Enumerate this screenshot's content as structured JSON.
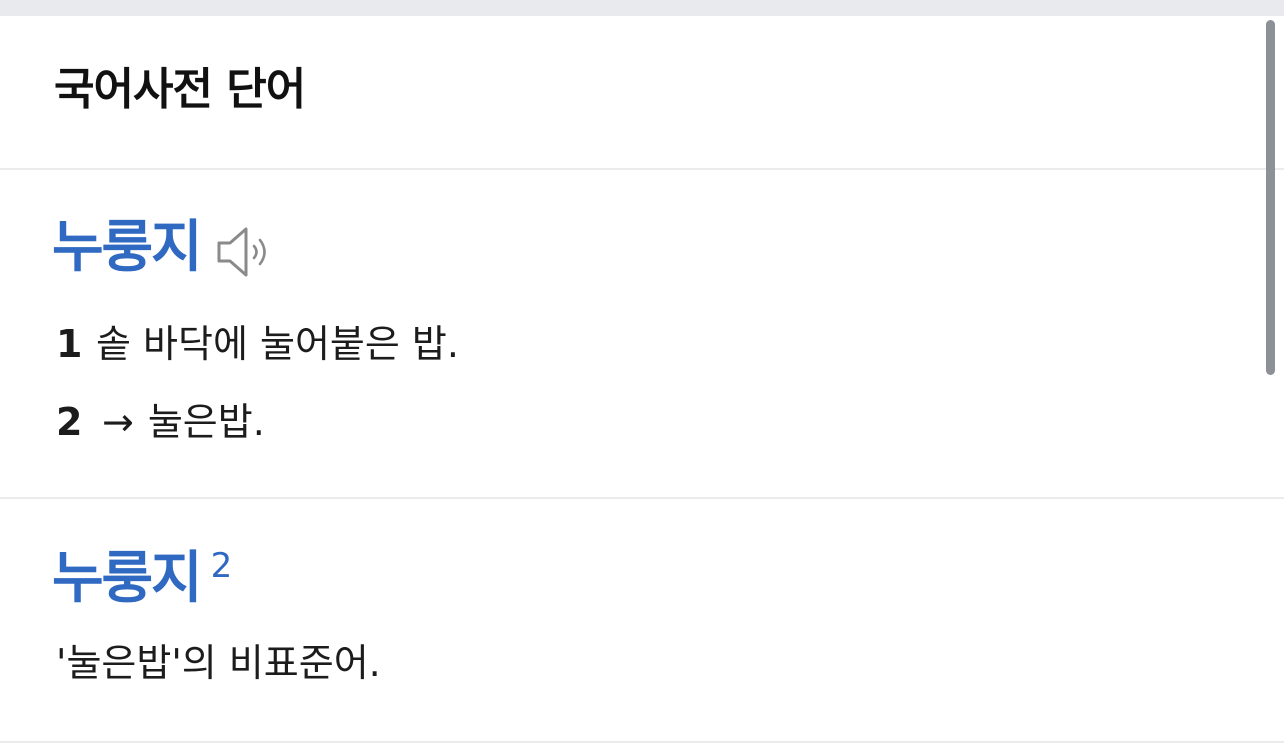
{
  "section": {
    "title": "국어사전 단어"
  },
  "entries": [
    {
      "headword": "누룽지",
      "audio_icon": "speaker-icon",
      "senses": [
        {
          "num": "1",
          "text": "솥 바닥에 눌어붙은 밥."
        },
        {
          "num": "2",
          "arrow": "→",
          "text": "눌은밥."
        }
      ]
    },
    {
      "headword": "누룽지",
      "homonym": "2",
      "definition": "'눌은밥'의 비표준어."
    }
  ],
  "colors": {
    "headword": "#2f69c2",
    "text": "#1c1c1c",
    "divider": "#ebebeb",
    "top_strip": "#e8eaee",
    "scrollbar": "#8d9096"
  }
}
